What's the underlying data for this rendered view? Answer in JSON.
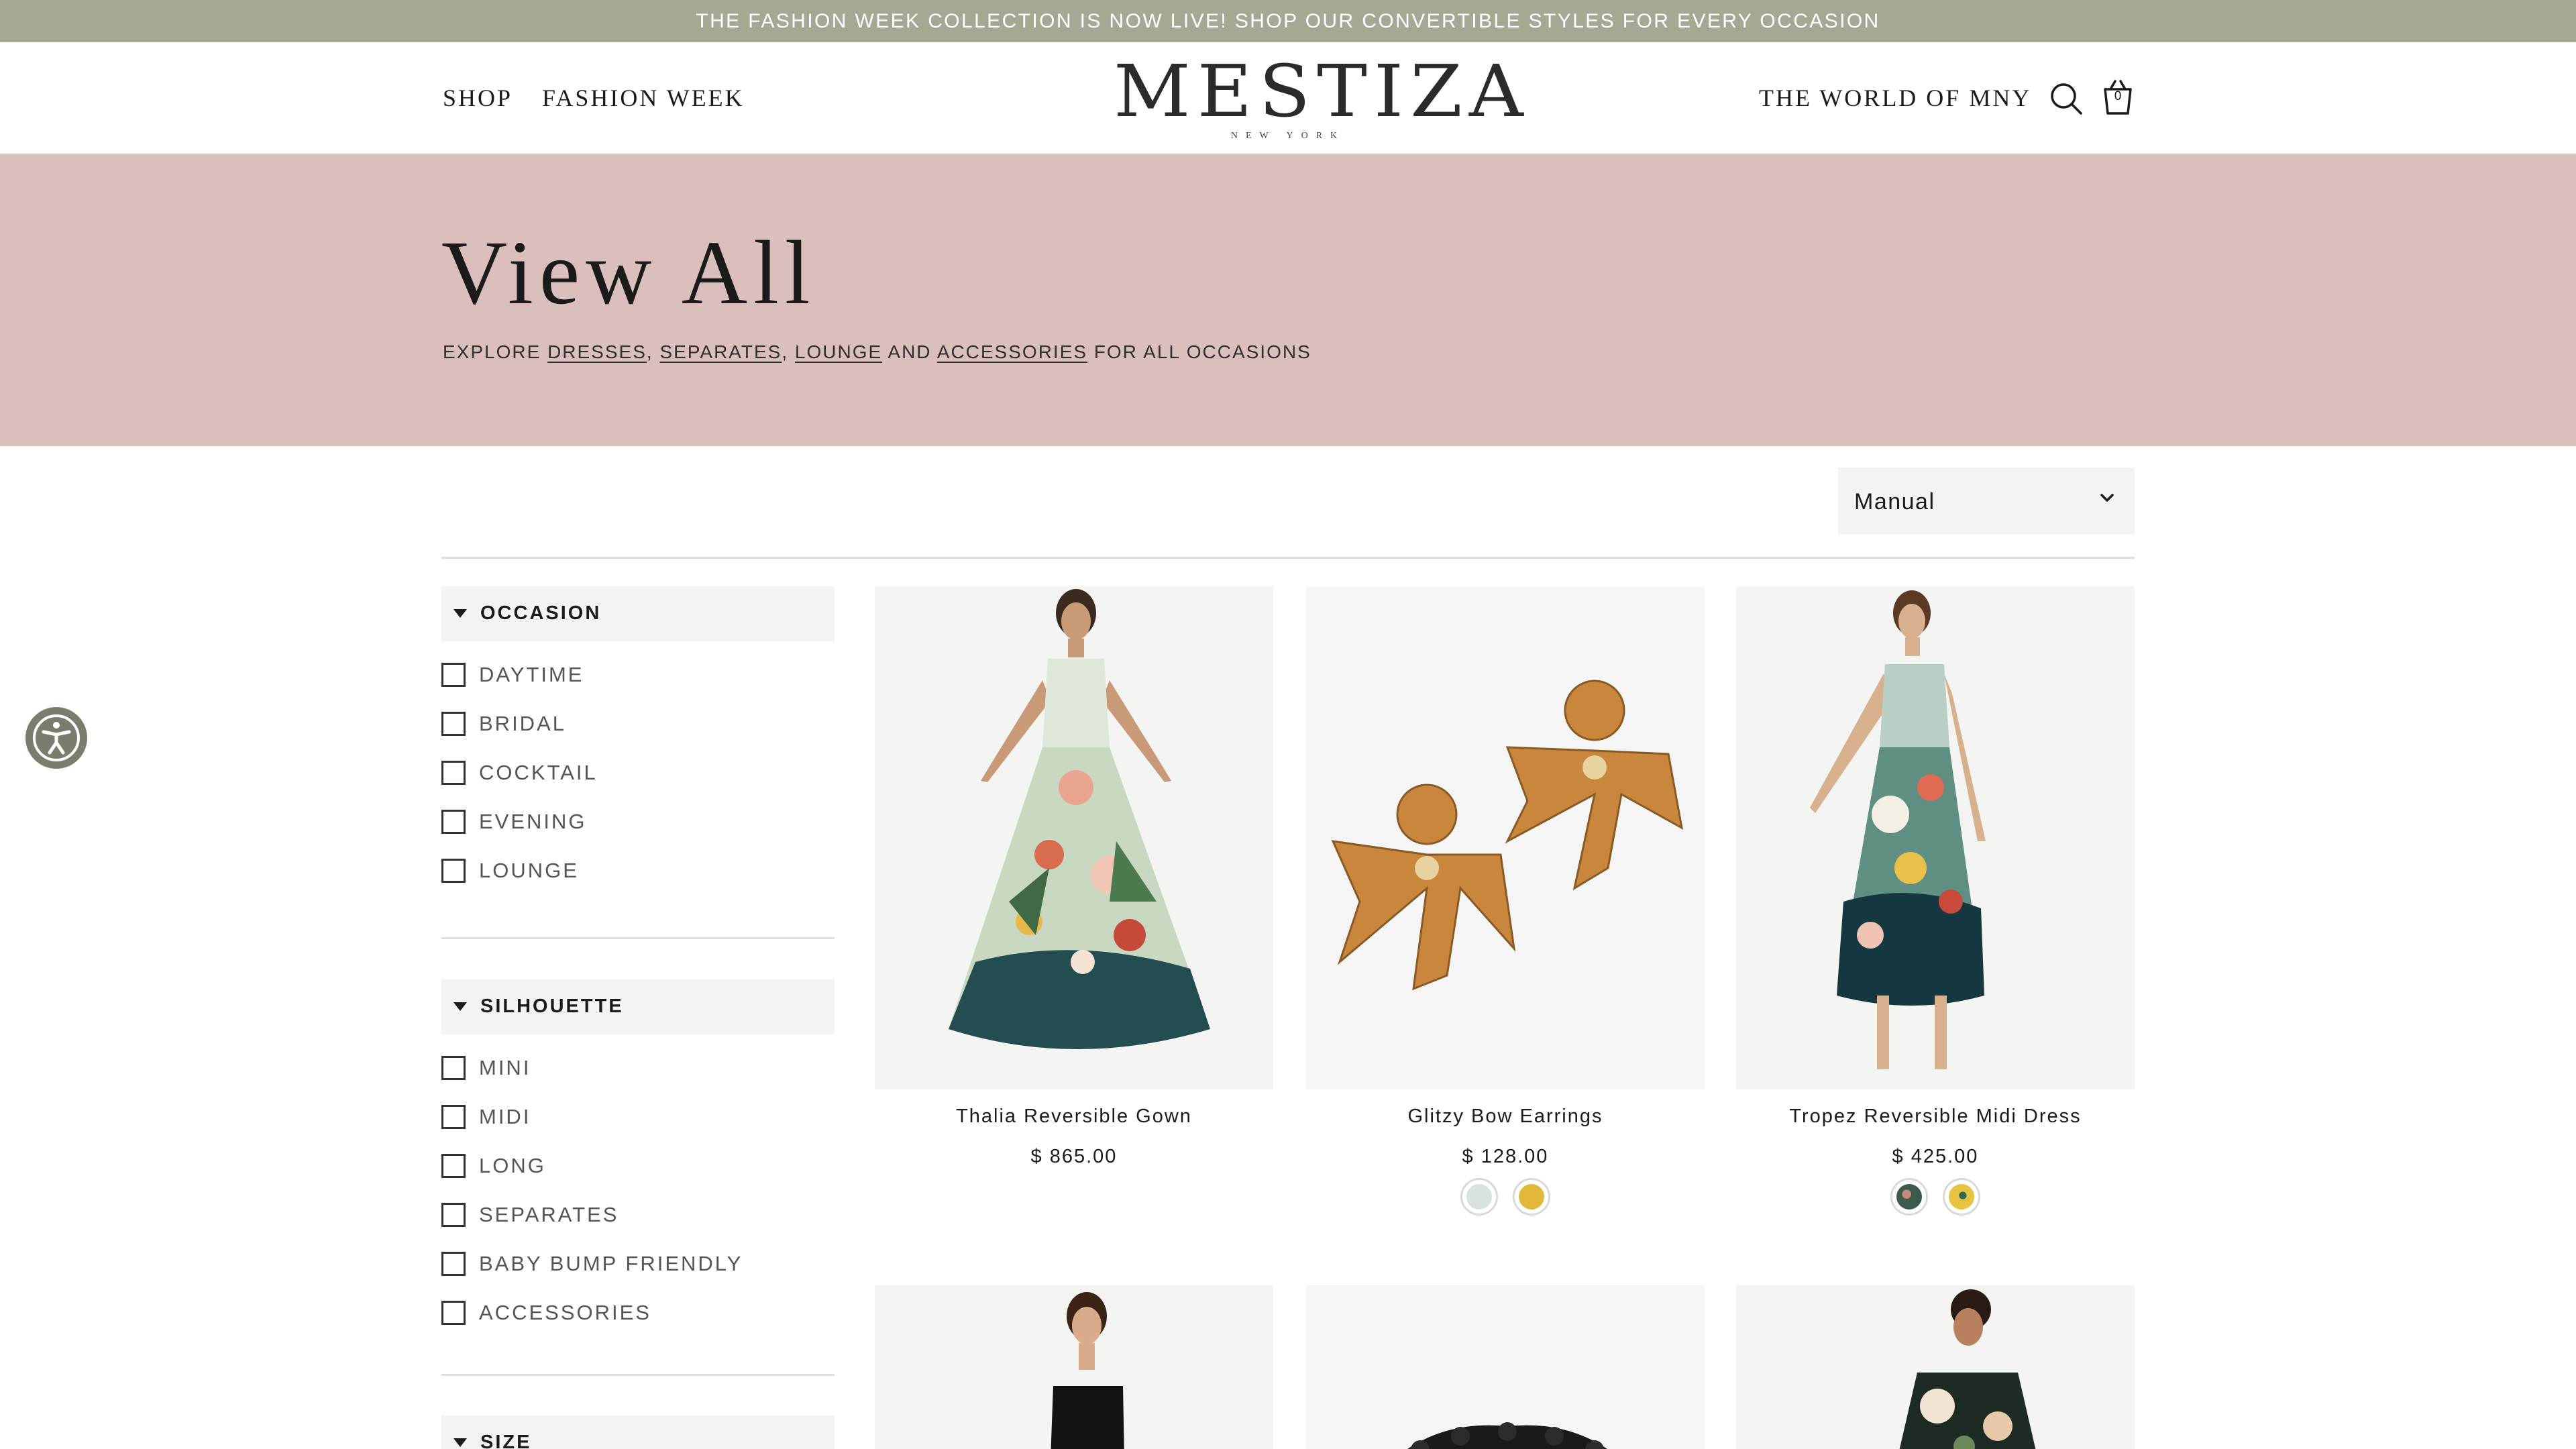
{
  "announcement": "THE FASHION WEEK COLLECTION IS NOW LIVE! SHOP OUR CONVERTIBLE STYLES FOR EVERY OCCASION",
  "nav": {
    "left": [
      "SHOP",
      "FASHION WEEK"
    ],
    "right": "THE WORLD OF MNY",
    "cart_count": "0",
    "search_icon": "search-icon",
    "cart_icon": "shopping-bag-icon"
  },
  "logo": {
    "main": "MESTIZA",
    "sub": "NEW YORK"
  },
  "hero": {
    "title": "View All",
    "sub_prefix": "EXPLORE",
    "links": [
      "DRESSES",
      "SEPARATES",
      "LOUNGE",
      "ACCESSORIES"
    ],
    "and_word": "AND",
    "sub_suffix": "FOR ALL OCCASIONS"
  },
  "sort": {
    "selected": "Manual"
  },
  "filters": [
    {
      "title": "OCCASION",
      "options": [
        "DAYTIME",
        "BRIDAL",
        "COCKTAIL",
        "EVENING",
        "LOUNGE"
      ]
    },
    {
      "title": "SILHOUETTE",
      "options": [
        "MINI",
        "MIDI",
        "LONG",
        "SEPARATES",
        "BABY BUMP FRIENDLY",
        "ACCESSORIES"
      ]
    },
    {
      "title": "SIZE",
      "options": []
    }
  ],
  "products": [
    {
      "name": "Thalia Reversible Gown",
      "price": "$ 865.00",
      "swatches": []
    },
    {
      "name": "Glitzy Bow Earrings",
      "price": "$ 128.00",
      "swatches": [
        "#d8e2e0",
        "#e2b83a"
      ]
    },
    {
      "name": "Tropez Reversible Midi Dress",
      "price": "$ 425.00",
      "swatches": [
        "#3c5a4e",
        "#e6c440"
      ]
    }
  ],
  "colors": {
    "announcement_bg": "#a5a993",
    "hero_bg": "#dbbfbc",
    "filter_header_bg": "#f4f3f1",
    "accessibility_button": "#7a7d6e"
  }
}
